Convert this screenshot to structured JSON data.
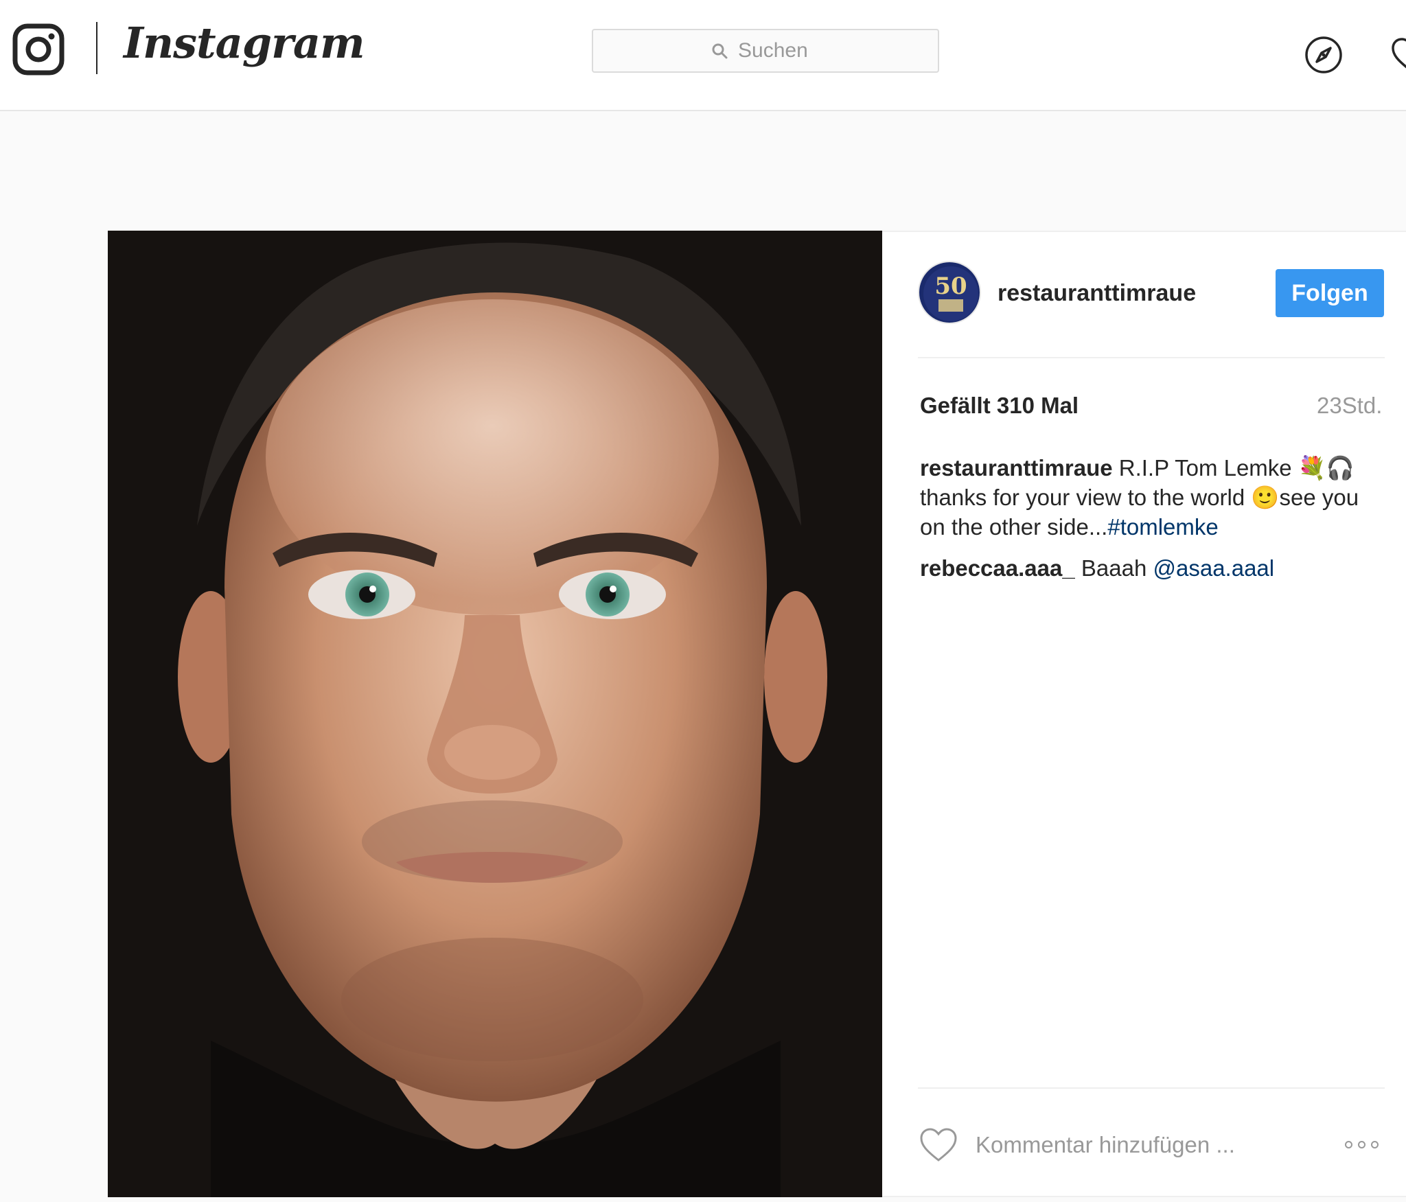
{
  "nav": {
    "brand": "Instagram",
    "search_placeholder": "Suchen"
  },
  "post": {
    "author": {
      "username": "restauranttimraue",
      "avatar_label": "50"
    },
    "follow_label": "Folgen",
    "likes": "Gefällt 310 Mal",
    "time_ago": "23Std.",
    "caption": {
      "user": "restauranttimraue",
      "text": "R.I.P Tom Lemke 💐🎧 thanks for your view to the world 🙂see you on the other side...",
      "hashtag": "#tomlemke"
    },
    "comments": [
      {
        "user": "rebeccaa.aaa_",
        "text": "Baaah",
        "mention": "@asaa.aaal"
      }
    ],
    "comment_placeholder": "Kommentar hinzufügen ...",
    "image_description": "portrait photo"
  },
  "colors": {
    "accent": "#3897f0",
    "link": "#003569",
    "muted": "#999999",
    "border": "#efefef"
  },
  "icons": [
    "instagram-camera-icon",
    "search-icon",
    "compass-icon",
    "heart-icon",
    "more-icon"
  ]
}
